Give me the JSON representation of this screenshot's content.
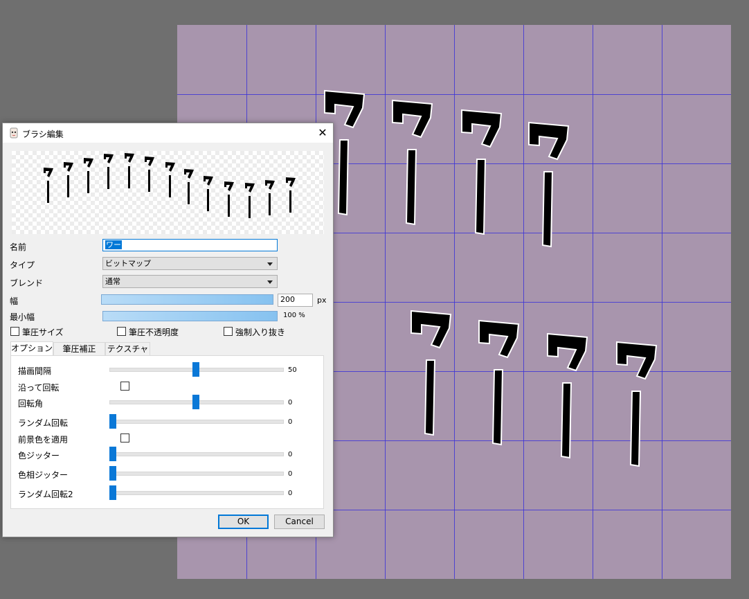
{
  "dialog": {
    "title": "ブラシ編集",
    "close_symbol": "✕",
    "fields": {
      "name_label": "名前",
      "name_value": "ワー",
      "type_label": "タイプ",
      "type_value": "ビットマップ",
      "blend_label": "ブレンド",
      "blend_value": "通常",
      "width_label": "幅",
      "width_value": "200",
      "width_unit": "px",
      "min_width_label": "最小幅",
      "min_width_value": "100 %"
    },
    "checkboxes": {
      "pressure_size": "筆圧サイズ",
      "pressure_opacity": "筆圧不透明度",
      "force_taper": "強制入り抜き"
    },
    "tabs": [
      "オプション",
      "筆圧補正",
      "テクスチャ"
    ],
    "options": {
      "spacing_label": "描画間隔",
      "spacing_value": "50",
      "spacing_fraction": 0.5,
      "rotate_along_label": "沿って回転",
      "rotation_label": "回転角",
      "rotation_value": "0",
      "rotation_fraction": 0.5,
      "random_rotation_label": "ランダム回転",
      "random_rotation_value": "0",
      "foreground_label": "前景色を適用",
      "color_jitter_label": "色ジッター",
      "color_jitter_value": "0",
      "hue_jitter_label": "色相ジッター",
      "hue_jitter_value": "0",
      "random_rotation2_label": "ランダム回転2",
      "random_rotation2_value": "0"
    },
    "ok_label": "OK",
    "cancel_label": "Cancel"
  },
  "canvas": {
    "background": "#a895ad",
    "grid_color": "#3e35d6",
    "glyph_char": "ワ"
  },
  "icons": [
    "brush-app-icon",
    "close-icon",
    "chevron-down-icon"
  ]
}
